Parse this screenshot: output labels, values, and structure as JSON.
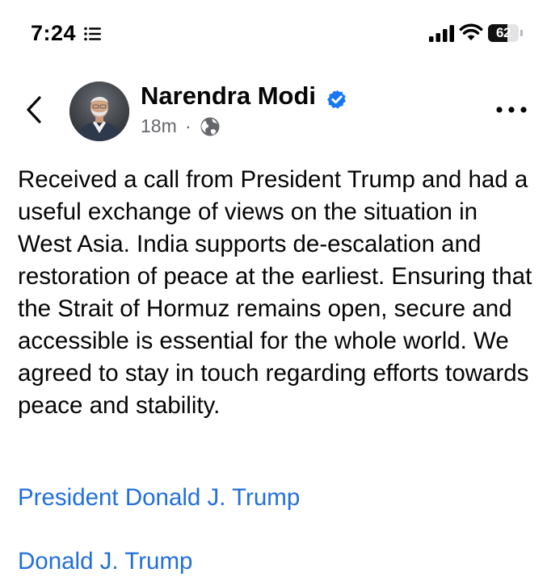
{
  "status_bar": {
    "time": "7:24",
    "battery_label": "62",
    "battery_level": 0.62,
    "icons": [
      "focus-list-icon",
      "cellular-signal-icon",
      "wifi-icon",
      "battery-icon"
    ]
  },
  "post": {
    "author": "Narendra Modi",
    "verified": true,
    "time_ago": "18m",
    "separator": "·",
    "audience_icon": "globe-icon",
    "text": "Received a call from President Trump and had a useful exchange of views on the situation in West Asia. India supports de-escalation and restoration of peace at the earliest. Ensuring that the Strait of Hormuz remains open, secure and accessible is essential for the whole world. We agreed to stay in touch regarding efforts towards peace and stability.",
    "tags": [
      "President Donald J. Trump",
      "Donald J. Trump"
    ]
  },
  "colors": {
    "link": "#216fdb",
    "verified": "#1877f2",
    "meta_text": "#65676b",
    "body_text": "#050505"
  },
  "icons": {
    "back": "chevron-left-icon",
    "more": "more-horizontal-icon",
    "verified": "verified-badge-icon"
  }
}
